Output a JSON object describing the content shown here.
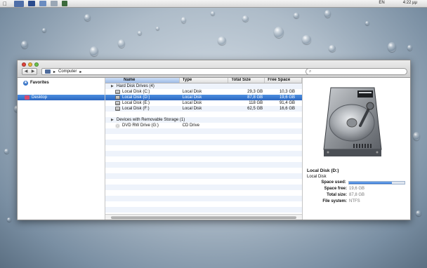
{
  "menubar": {
    "lang": "EN",
    "clock": "4:22 μμ"
  },
  "toolbar": {
    "back": "◀",
    "forward": "▶",
    "address_label": "Computer",
    "address_sep": "▸",
    "dropdown": "▾",
    "refresh": "⟳",
    "search_placeholder": "⌕"
  },
  "sidebar": {
    "favorites_label": "Favorites",
    "items": [
      {
        "label": "Desktop"
      }
    ]
  },
  "columns": {
    "name": "Name",
    "type": "Type",
    "total": "Total Size",
    "free": "Free Space"
  },
  "groups": [
    {
      "label": "Hard Disk Drives (4)",
      "items": [
        {
          "name": "Local Disk (C:)",
          "type": "Local Disk",
          "total": "29,3 GB",
          "free": "10,3 GB"
        },
        {
          "name": "Local Disk (D:)",
          "type": "Local Disk",
          "total": "87,8 GB",
          "free": "19,6 GB"
        },
        {
          "name": "Local Disk (E:)",
          "type": "Local Disk",
          "total": "118 GB",
          "free": "91,4 GB"
        },
        {
          "name": "Local Disk (F:)",
          "type": "Local Disk",
          "total": "62,5 GB",
          "free": "16,6 GB"
        }
      ]
    },
    {
      "label": "Devices with Removable Storage (1)",
      "items": [
        {
          "name": "DVD RW Drive (G:)",
          "type": "CD Drive",
          "total": "",
          "free": ""
        }
      ]
    }
  ],
  "selected_index": 1,
  "preview": {
    "title": "Local Disk (D:)",
    "type": "Local Disk",
    "space_used_label": "Space used:",
    "space_used_fraction": 0.777,
    "space_free_label": "Space free:",
    "space_free": "19,6 GB",
    "total_size_label": "Total size:",
    "total_size": "87,8 GB",
    "fs_label": "File system:",
    "fs": "NTFS"
  },
  "colors": {
    "selection": "#2b66c0",
    "accent": "#4c8fe0"
  }
}
